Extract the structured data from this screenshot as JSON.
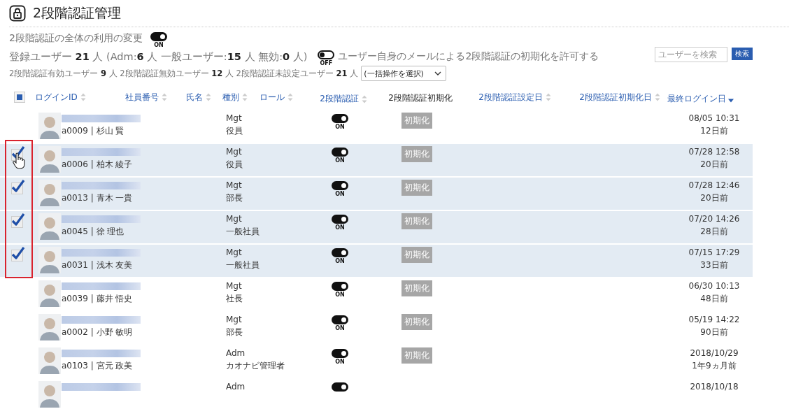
{
  "page": {
    "title": "2段階認証管理"
  },
  "global_toggle": {
    "label": "2段階認証の全体の利用の変更",
    "on": true,
    "state_text": "ON"
  },
  "summary": {
    "parts": [
      {
        "text": "登録ユーザー ",
        "bold": false
      },
      {
        "text": "21",
        "bold": true
      },
      {
        "text": " 人 (Adm:",
        "bold": false
      },
      {
        "text": "6",
        "bold": true
      },
      {
        "text": " 人 一般ユーザー:",
        "bold": false
      },
      {
        "text": "15",
        "bold": true
      },
      {
        "text": " 人 無効:",
        "bold": false
      },
      {
        "text": "0",
        "bold": true
      },
      {
        "text": " 人)",
        "bold": false
      }
    ]
  },
  "self_reset_toggle": {
    "label": "ユーザー自身のメールによる2段階認証の初期化を許可する",
    "on": false,
    "state_text": "OFF"
  },
  "search": {
    "placeholder": "ユーザーを検索",
    "button": "検索"
  },
  "counts": {
    "parts": [
      {
        "text": "2段階認証有効ユーザー ",
        "bold": false
      },
      {
        "text": "9",
        "bold": true
      },
      {
        "text": " 人 2段階認証無効ユーザー ",
        "bold": false
      },
      {
        "text": "12",
        "bold": true
      },
      {
        "text": " 人 2段階認証未設定ユーザー ",
        "bold": false
      },
      {
        "text": "21",
        "bold": true
      },
      {
        "text": " 人",
        "bold": false
      }
    ]
  },
  "bulk_action": {
    "value": "(一括操作を選択)"
  },
  "table": {
    "select_all": {
      "indeterminate": true
    },
    "columns": [
      {
        "label": "ログインID",
        "sortable": true,
        "sorted": false
      },
      {
        "label": "社員番号",
        "sortable": true,
        "sorted": false
      },
      {
        "label": "氏名",
        "sortable": true,
        "sorted": false
      },
      {
        "label": "種別",
        "sortable": true,
        "sorted": false
      },
      {
        "label": "ロール",
        "sortable": true,
        "sorted": false
      },
      {
        "label": "2段階認証",
        "sortable": true,
        "sorted": false
      },
      {
        "label": "2段階認証初期化",
        "sortable": false
      },
      {
        "label": "2段階認証設定日",
        "sortable": true,
        "sorted": false
      },
      {
        "label": "2段階認証初期化日",
        "sortable": true,
        "sorted": false
      },
      {
        "label": "最終ログイン日",
        "sortable": true,
        "sorted": true
      }
    ],
    "rows": [
      {
        "selected": false,
        "user": "a0009 | 杉山 賢",
        "type": "Mgt",
        "role": "役員",
        "two_factor": {
          "on": true,
          "state_text": "ON"
        },
        "reset": "初期化",
        "last_login": "08/05 10:31",
        "ago": "12日前"
      },
      {
        "selected": true,
        "user": "a0006 | 柏木 綾子",
        "type": "Mgt",
        "role": "役員",
        "two_factor": {
          "on": true,
          "state_text": "ON"
        },
        "reset": "初期化",
        "last_login": "07/28 12:58",
        "ago": "20日前"
      },
      {
        "selected": true,
        "user": "a0013 | 青木 一貴",
        "type": "Mgt",
        "role": "部長",
        "two_factor": {
          "on": true,
          "state_text": "ON"
        },
        "reset": "初期化",
        "last_login": "07/28 12:46",
        "ago": "20日前"
      },
      {
        "selected": true,
        "user": "a0045 | 徐 理也",
        "type": "Mgt",
        "role": "一般社員",
        "two_factor": {
          "on": true,
          "state_text": "ON"
        },
        "reset": "初期化",
        "last_login": "07/20 14:26",
        "ago": "28日前"
      },
      {
        "selected": true,
        "user": "a0031 | 浅木 友美",
        "type": "Mgt",
        "role": "一般社員",
        "two_factor": {
          "on": true,
          "state_text": "ON"
        },
        "reset": "初期化",
        "last_login": "07/15 17:29",
        "ago": "33日前"
      },
      {
        "selected": false,
        "user": "a0039 | 藤井 悟史",
        "type": "Mgt",
        "role": "社長",
        "two_factor": {
          "on": true,
          "state_text": "ON"
        },
        "reset": "初期化",
        "last_login": "06/30 10:13",
        "ago": "48日前"
      },
      {
        "selected": false,
        "user": "a0002 | 小野 敏明",
        "type": "Mgt",
        "role": "部長",
        "two_factor": {
          "on": true,
          "state_text": "ON"
        },
        "reset": "初期化",
        "last_login": "05/19 14:22",
        "ago": "90日前"
      },
      {
        "selected": false,
        "user": "a0103 | 宮元 政美",
        "type": "Adm",
        "role": "カオナビ管理者",
        "two_factor": {
          "on": true,
          "state_text": "ON"
        },
        "reset": "初期化",
        "last_login": "2018/10/29",
        "ago": "1年9ヵ月前"
      },
      {
        "selected": false,
        "type": "Adm",
        "two_factor": {
          "on": true
        },
        "last_login": "2018/10/18"
      }
    ]
  }
}
